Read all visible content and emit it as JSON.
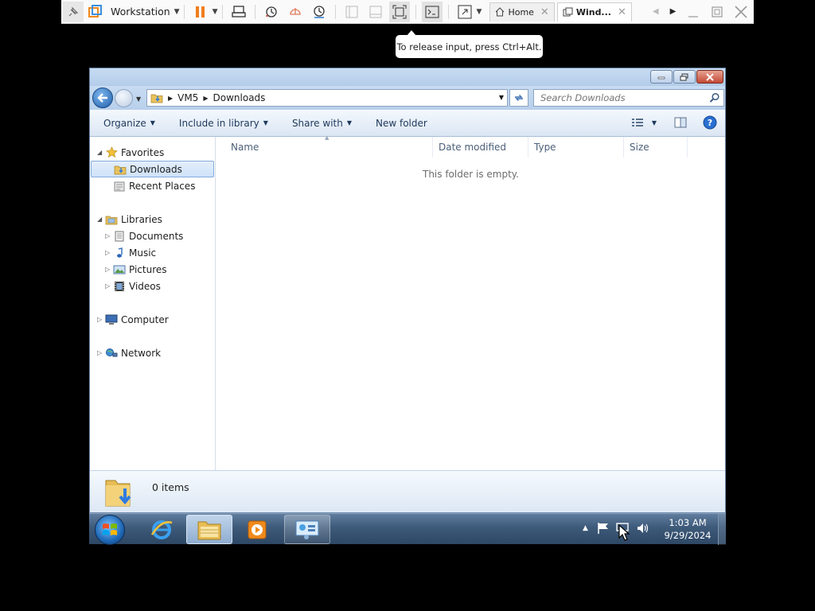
{
  "vmware": {
    "product_name": "Workstation",
    "tabs": [
      {
        "label": "Home"
      },
      {
        "label": "Wind..."
      }
    ],
    "tooltip": "To release input, press Ctrl+Alt."
  },
  "explorer": {
    "breadcrumb": [
      "VM5",
      "Downloads"
    ],
    "search_placeholder": "Search Downloads",
    "commands": {
      "organize": "Organize",
      "include_in_library": "Include in library",
      "share_with": "Share with",
      "new_folder": "New folder"
    },
    "nav": {
      "favorites": "Favorites",
      "downloads": "Downloads",
      "recent_places": "Recent Places",
      "libraries": "Libraries",
      "documents": "Documents",
      "music": "Music",
      "pictures": "Pictures",
      "videos": "Videos",
      "computer": "Computer",
      "network": "Network"
    },
    "columns": [
      "Name",
      "Date modified",
      "Type",
      "Size"
    ],
    "empty_message": "This folder is empty.",
    "details": {
      "item_count": "0 items"
    }
  },
  "taskbar": {
    "clock_time": "1:03 AM",
    "clock_date": "9/29/2024"
  },
  "colors": {
    "vmware_pause": "#f07d1c",
    "win7_blue": "#1e67b5",
    "command_text": "#1e395b"
  }
}
